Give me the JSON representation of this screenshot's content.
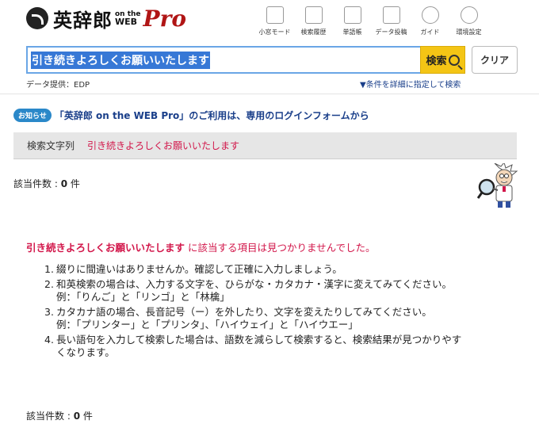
{
  "header": {
    "logo": {
      "brand": "英辞郎",
      "on_the": "on the",
      "web": "WEB",
      "pro": "Pro"
    },
    "toolbar": [
      {
        "label": "小窓モード",
        "icon": "small-window-icon"
      },
      {
        "label": "検索履歴",
        "icon": "history-clock-icon"
      },
      {
        "label": "単語帳",
        "icon": "wordbook-icon"
      },
      {
        "label": "データ投稿",
        "icon": "data-post-icon"
      },
      {
        "label": "ガイド",
        "icon": "help-question-icon"
      },
      {
        "label": "環境設定",
        "icon": "gear-icon"
      }
    ],
    "search": {
      "value": "引き続きよろしくお願いいたします",
      "button_label": "検索",
      "clear_label": "クリア"
    },
    "provider": "データ提供：EDP",
    "advanced_search": "▼条件を詳細に指定して検索"
  },
  "notice": {
    "badge": "お知らせ",
    "text": "「英辞郎 on the WEB Pro」のご利用は、専用のログインフォームから"
  },
  "query_bar": {
    "label": "検索文字列",
    "value": "引き続きよろしくお願いいたします"
  },
  "result_count": {
    "label": "該当件数 : ",
    "value": "0",
    "unit": " 件"
  },
  "message": {
    "query": "引き続きよろしくお願いいたします",
    "rest": " に該当する項目は見つかりませんでした。"
  },
  "tips": [
    {
      "num": "1.",
      "lines": [
        "綴りに間違いはありませんか。確認して正確に入力しましょう。"
      ]
    },
    {
      "num": "2.",
      "lines": [
        "和英検索の場合は、入力する文字を、ひらがな・カタカナ・漢字に変えてみてください。",
        "例：「りんご」と「リンゴ」と「林檎」"
      ]
    },
    {
      "num": "3.",
      "lines": [
        "カタカナ語の場合、長音記号（ー）を外したり、文字を変えたりしてみてください。",
        "例：「プリンター」と「プリンタ」、「ハイウェイ」と「ハイウエー」"
      ]
    },
    {
      "num": "4.",
      "lines": [
        "長い語句を入力して検索した場合は、語数を減らして検索すると、検索結果が見つかりやす",
        "くなります。"
      ]
    }
  ],
  "colors": {
    "accent_red": "#d2164a",
    "link_blue": "#1a3f8a",
    "search_yellow": "#f4c515",
    "selection_blue": "#3778d6"
  }
}
